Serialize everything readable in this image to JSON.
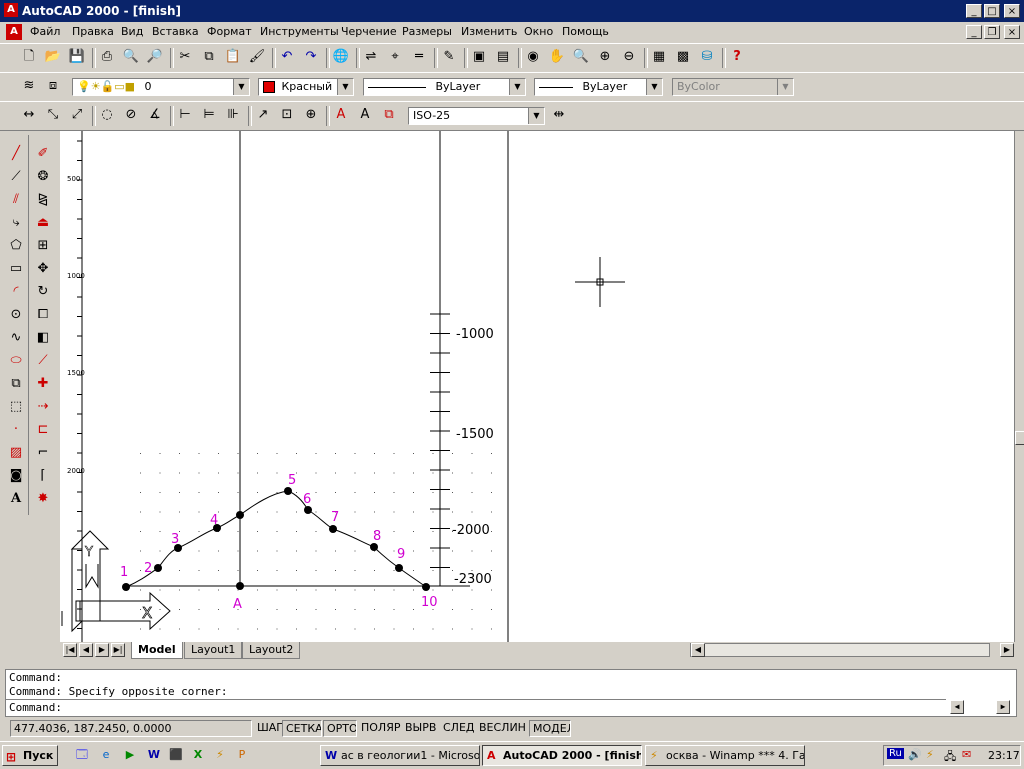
{
  "window": {
    "title": "AutoCAD 2000 - [finish]",
    "app_icon": "A"
  },
  "menu": [
    "Файл",
    "Правка",
    "Вид",
    "Вставка",
    "Формат",
    "Инструменты",
    "Черчение",
    "Размеры",
    "Изменить",
    "Окно",
    "Помощь"
  ],
  "properties_bar": {
    "layer_value": "0",
    "color_value": "Красный",
    "color_swatch": "#e00000",
    "linetype_value": "ByLayer",
    "lineweight_value": "ByLayer",
    "plotstyle_value": "ByColor"
  },
  "dim_bar": {
    "dimstyle_value": "ISO-25"
  },
  "drawing": {
    "ruler_labels": [
      "500",
      "1000",
      "1500",
      "2000"
    ],
    "scale_labels": [
      "-1000",
      "-1500",
      "-2000",
      "-2300"
    ],
    "point_labels": [
      "1",
      "2",
      "3",
      "4",
      "5",
      "6",
      "7",
      "8",
      "9",
      "10"
    ],
    "marker_label": "A",
    "ucs_y": "Y",
    "ucs_x": "X",
    "label_color": "#d000d0"
  },
  "tabs": [
    "Model",
    "Layout1",
    "Layout2"
  ],
  "command": {
    "line1": "Command:",
    "line2": "Command: Specify opposite corner:",
    "prompt": "Command:"
  },
  "status": {
    "coords": "477.4036, 187.2450, 0.0000",
    "toggles": [
      "ШАГ",
      "СЕТКА",
      "ОРТО",
      "ПОЛЯР",
      "ВЫРВ",
      "СЛЕД",
      "ВЕСЛИН",
      "МОДЕЛ"
    ]
  },
  "taskbar": {
    "start": "Пуск",
    "tasks": [
      "ас в геологии1 - Microsof...",
      "AutoCAD 2000 - [finish]",
      "осква - Winamp *** 4. Газ..."
    ],
    "tray_lang": "Ru",
    "clock": "23:17"
  }
}
